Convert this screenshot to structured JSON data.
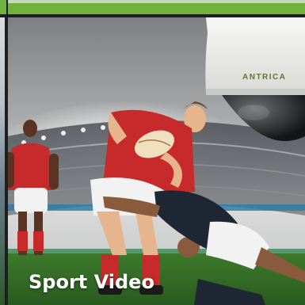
{
  "card": {
    "title": "Sport Video",
    "camera_brand": "ANTRICA"
  },
  "colors": {
    "accent_green": "#6fb33a",
    "title_text": "#ffffff",
    "camera_body": "#f0f0ee",
    "home_jersey": "#c62a2a",
    "away_jersey": "#1f2734"
  },
  "icons": {
    "camera": "dome-camera-icon"
  }
}
